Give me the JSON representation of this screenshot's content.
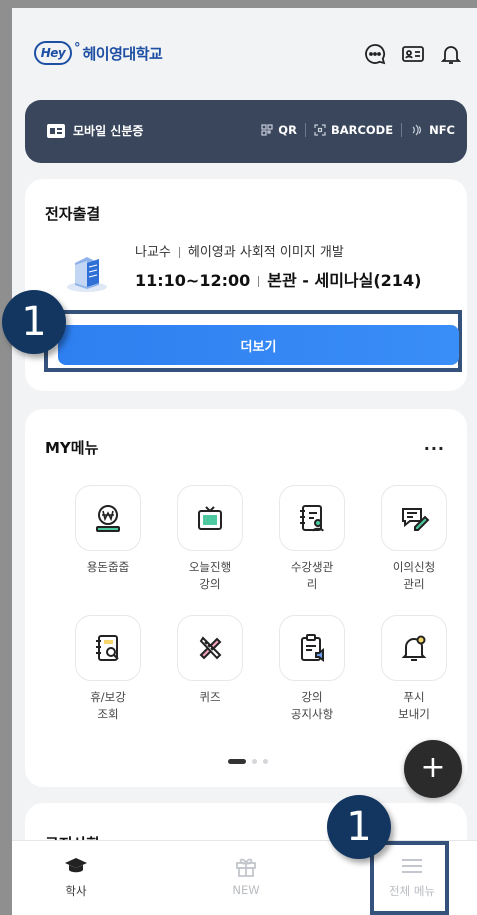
{
  "header": {
    "logo_badge": "Hey",
    "logo_dot": "°",
    "logo_text": "헤이영대학교",
    "icons": [
      "chat-icon",
      "id-card-icon",
      "bell-icon"
    ]
  },
  "mobile_id": {
    "label": "모바일 신분증",
    "options": [
      "QR",
      "BARCODE",
      "NFC"
    ]
  },
  "attendance": {
    "title": "전자출결",
    "professor": "나교수",
    "course": "헤이영과 사회적 이미지 개발",
    "time": "11:10~12:00",
    "room": "본관 - 세미나실(214)",
    "more_button": "더보기"
  },
  "my_menu": {
    "title": "MY메뉴",
    "more": "···",
    "items": [
      {
        "label": "용돈줍줍",
        "icon": "coin-scale-icon"
      },
      {
        "label": "오늘진행\n강의",
        "icon": "monitor-icon"
      },
      {
        "label": "수강생관\n리",
        "icon": "student-book-icon"
      },
      {
        "label": "이의신청\n관리",
        "icon": "edit-message-icon"
      },
      {
        "label": "휴/보강\n조회",
        "icon": "notebook-search-icon"
      },
      {
        "label": "퀴즈",
        "icon": "tools-icon"
      },
      {
        "label": "강의\n공지사항",
        "icon": "clipboard-speaker-icon"
      },
      {
        "label": "푸시\n보내기",
        "icon": "bell-push-icon"
      }
    ]
  },
  "notice": {
    "title": "공지사항",
    "more": "···"
  },
  "fab": "+",
  "tabs": [
    {
      "label": "학사",
      "icon": "graduation-cap-icon"
    },
    {
      "label": "NEW",
      "icon": "gift-icon"
    },
    {
      "label": "전체 메뉴",
      "icon": "hamburger-menu-icon"
    }
  ],
  "badges": [
    "1",
    "1"
  ],
  "colors": {
    "brand": "#1d4fa3",
    "id_card_bg": "#3a465c",
    "primary_button": "#3186f4",
    "highlight_border": "#35527c",
    "badge_bg": "#123660"
  }
}
